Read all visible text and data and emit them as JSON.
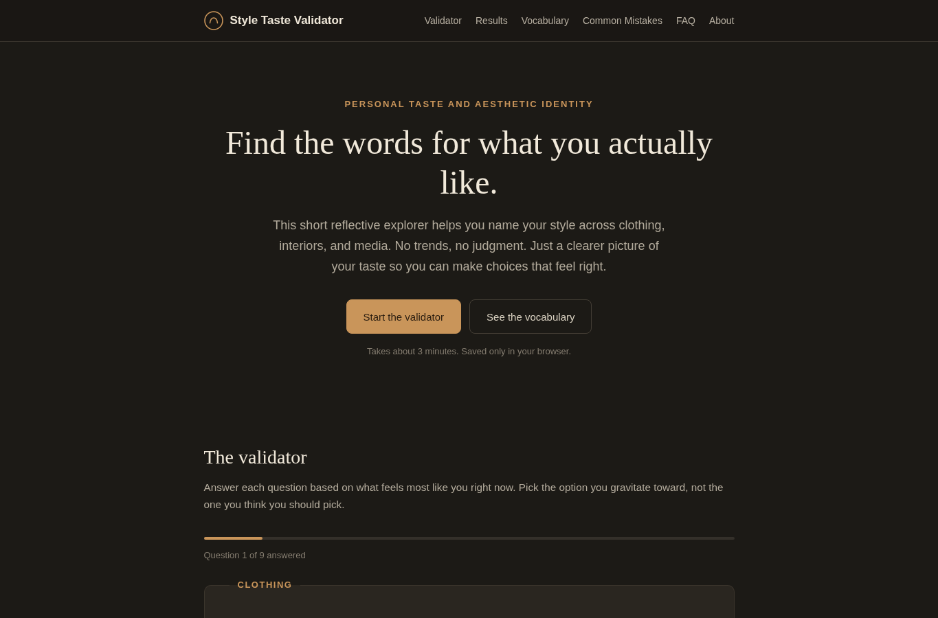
{
  "header": {
    "brand": "Style Taste Validator",
    "nav": [
      {
        "label": "Validator"
      },
      {
        "label": "Results"
      },
      {
        "label": "Vocabulary"
      },
      {
        "label": "Common Mistakes"
      },
      {
        "label": "FAQ"
      },
      {
        "label": "About"
      }
    ]
  },
  "hero": {
    "eyebrow": "PERSONAL TASTE AND AESTHETIC IDENTITY",
    "title": "Find the words for what you actually like.",
    "intro": "This short reflective explorer helps you name your style across clothing, interiors, and media. No trends, no judgment. Just a clearer picture of your taste so you can make choices that feel right.",
    "buttons": [
      {
        "label": "Start the validator",
        "kind": "primary"
      },
      {
        "label": "See the vocabulary",
        "kind": "secondary"
      }
    ],
    "note": "Takes about 3 minutes. Saved only in your browser."
  },
  "validator": {
    "title": "The validator",
    "intro": "Answer each question based on what feels most like you right now. Pick the option you gravitate toward, not the one you think you should pick.",
    "progress": {
      "level": 0.111
    },
    "progress_text": "Question 1 of 9 answered",
    "question": {
      "category": "CLOTHING"
    }
  }
}
